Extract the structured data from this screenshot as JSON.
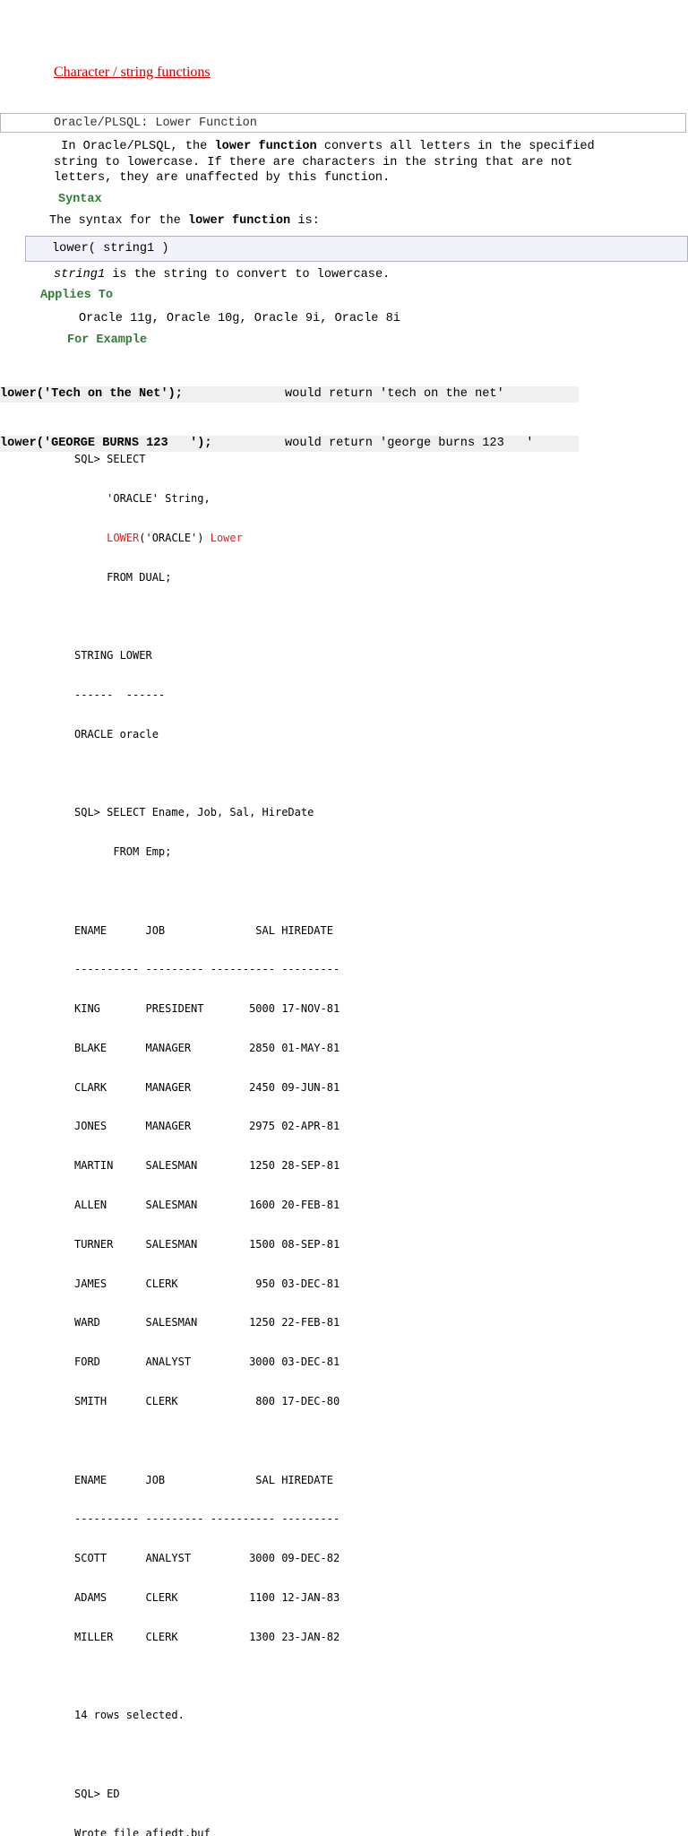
{
  "heading": "Character / string functions",
  "section_title": "Oracle/PLSQL: Lower Function",
  "intro": {
    "line1_pre": " In Oracle/PLSQL, the ",
    "line1_bold": "lower function",
    "line1_post": " converts all letters in the specified",
    "line2": "string to lowercase. If there are characters in the string that are not",
    "line3": "letters, they are unaffected by this function."
  },
  "syntax": {
    "heading": "Syntax",
    "line_pre": "The syntax for the ",
    "line_bold": "lower function",
    "line_post": " is:",
    "code": "lower( string1 )"
  },
  "param": {
    "name": "string1",
    "desc": " is the string to convert to lowercase."
  },
  "applies": {
    "heading": "Applies To",
    "versions": "Oracle 11g, Oracle 10g, Oracle 9i, Oracle 8i"
  },
  "examples": {
    "heading": "For Example",
    "rows": [
      {
        "call": "lower('Tech on the Net');",
        "result": "would return 'tech on the net'"
      },
      {
        "call": "lower('GEORGE BURNS 123   ');",
        "result": "would return 'george burns 123   '"
      }
    ]
  },
  "sql": {
    "l01": "SQL> SELECT",
    "l02": "     'ORACLE' String,",
    "l03_pad": "     ",
    "l03_fn": "LOWER",
    "l03_arg": "('ORACLE') ",
    "l03_alias": "Lower",
    "l04": "     FROM DUAL;",
    "l05": "",
    "l06": "STRING LOWER",
    "l07": "------  ------",
    "l08": "ORACLE oracle",
    "l09": "",
    "l10": "SQL> SELECT Ename, Job, Sal, HireDate",
    "l11": "      FROM Emp;",
    "l12": "",
    "l13": "ENAME      JOB              SAL HIREDATE",
    "l14": "---------- --------- ---------- ---------",
    "l15": "KING       PRESIDENT       5000 17-NOV-81",
    "l16": "BLAKE      MANAGER         2850 01-MAY-81",
    "l17": "CLARK      MANAGER         2450 09-JUN-81",
    "l18": "JONES      MANAGER         2975 02-APR-81",
    "l19": "MARTIN     SALESMAN        1250 28-SEP-81",
    "l20": "ALLEN      SALESMAN        1600 20-FEB-81",
    "l21": "TURNER     SALESMAN        1500 08-SEP-81",
    "l22": "JAMES      CLERK            950 03-DEC-81",
    "l23": "WARD       SALESMAN        1250 22-FEB-81",
    "l24": "FORD       ANALYST         3000 03-DEC-81",
    "l25": "SMITH      CLERK            800 17-DEC-80",
    "l26": "",
    "l27": "ENAME      JOB              SAL HIREDATE",
    "l28": "---------- --------- ---------- ---------",
    "l29": "SCOTT      ANALYST         3000 09-DEC-82",
    "l30": "ADAMS      CLERK           1100 12-JAN-83",
    "l31": "MILLER     CLERK           1300 23-JAN-82",
    "l32": "",
    "l33": "14 rows selected.",
    "l34": "",
    "l35": "SQL> ED",
    "l36": "Wrote file afiedt.buf"
  }
}
